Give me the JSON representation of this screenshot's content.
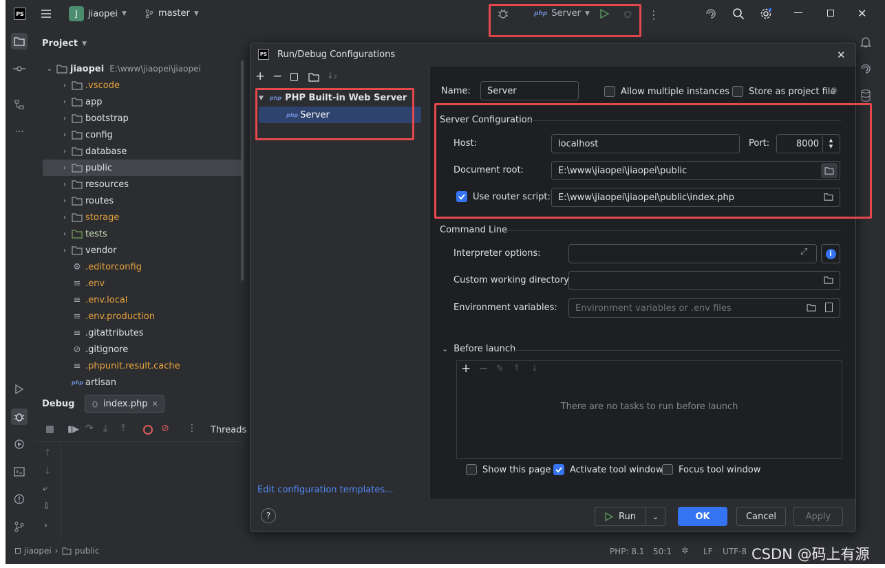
{
  "titlebar": {
    "app_badge": "PS",
    "project_badge": "J",
    "project_name": "jiaopei",
    "branch": "master",
    "run_config": "Server"
  },
  "project_panel": {
    "title": "Project",
    "root_name": "jiaopei",
    "root_path": "E:\\www\\jiaopei\\jiaopei",
    "items": [
      {
        "label": ".vscode",
        "type": "folder",
        "color": "orange"
      },
      {
        "label": "app",
        "type": "folder",
        "color": "default"
      },
      {
        "label": "bootstrap",
        "type": "folder",
        "color": "default"
      },
      {
        "label": "config",
        "type": "folder",
        "color": "default"
      },
      {
        "label": "database",
        "type": "folder",
        "color": "default"
      },
      {
        "label": "public",
        "type": "folder",
        "color": "default",
        "selected": true
      },
      {
        "label": "resources",
        "type": "folder",
        "color": "default"
      },
      {
        "label": "routes",
        "type": "folder",
        "color": "default"
      },
      {
        "label": "storage",
        "type": "folder",
        "color": "orange"
      },
      {
        "label": "tests",
        "type": "folder",
        "color": "green"
      },
      {
        "label": "vendor",
        "type": "folder",
        "color": "default"
      },
      {
        "label": ".editorconfig",
        "type": "gear-file",
        "color": "orange"
      },
      {
        "label": ".env",
        "type": "text-file",
        "color": "orange"
      },
      {
        "label": ".env.local",
        "type": "text-file",
        "color": "orange"
      },
      {
        "label": ".env.production",
        "type": "text-file",
        "color": "orange"
      },
      {
        "label": ".gitattributes",
        "type": "text-file",
        "color": "default"
      },
      {
        "label": ".gitignore",
        "type": "ignore-file",
        "color": "default"
      },
      {
        "label": ".phpunit.result.cache",
        "type": "text-file",
        "color": "orange"
      },
      {
        "label": "artisan",
        "type": "php-file",
        "color": "default"
      }
    ]
  },
  "debug_panel": {
    "title": "Debug",
    "tab": "index.php",
    "threads": "Threads"
  },
  "dialog": {
    "title": "Run/Debug Configurations",
    "tree_group": "PHP Built-in Web Server",
    "tree_item": "Server",
    "edit_templates": "Edit configuration templates...",
    "name_label": "Name:",
    "name_value": "Server",
    "allow_multiple": "Allow multiple instances",
    "store_as_file": "Store as project file",
    "server_config_title": "Server Configuration",
    "host_label": "Host:",
    "host_value": "localhost",
    "port_label": "Port:",
    "port_value": "8000",
    "docroot_label": "Document root:",
    "docroot_value": "E:\\www\\jiaopei\\jiaopei\\public",
    "router_label": "Use router script:",
    "router_value": "E:\\www\\jiaopei\\jiaopei\\public\\index.php",
    "router_checked": true,
    "command_line_title": "Command Line",
    "interp_label": "Interpreter options:",
    "cwd_label": "Custom working directory:",
    "env_label": "Environment variables:",
    "env_placeholder": "Environment variables or .env files",
    "before_launch": "Before launch",
    "no_tasks": "There are no tasks to run before launch",
    "show_page": "Show this page",
    "activate_tool": "Activate tool window",
    "focus_tool": "Focus tool window",
    "run": "Run",
    "ok": "OK",
    "cancel": "Cancel",
    "apply": "Apply",
    "help": "?"
  },
  "statusbar": {
    "crumb_project": "jiaopei",
    "crumb_folder": "public",
    "php_version": "PHP: 8.1",
    "position": "50:1",
    "line_sep": "LF",
    "encoding": "UTF-8"
  },
  "watermark": "CSDN @码上有源",
  "colors": {
    "accent": "#3574f0",
    "highlight_red": "#e5484d",
    "bg": "#2b2d30",
    "editor_bg": "#1e1f22"
  }
}
